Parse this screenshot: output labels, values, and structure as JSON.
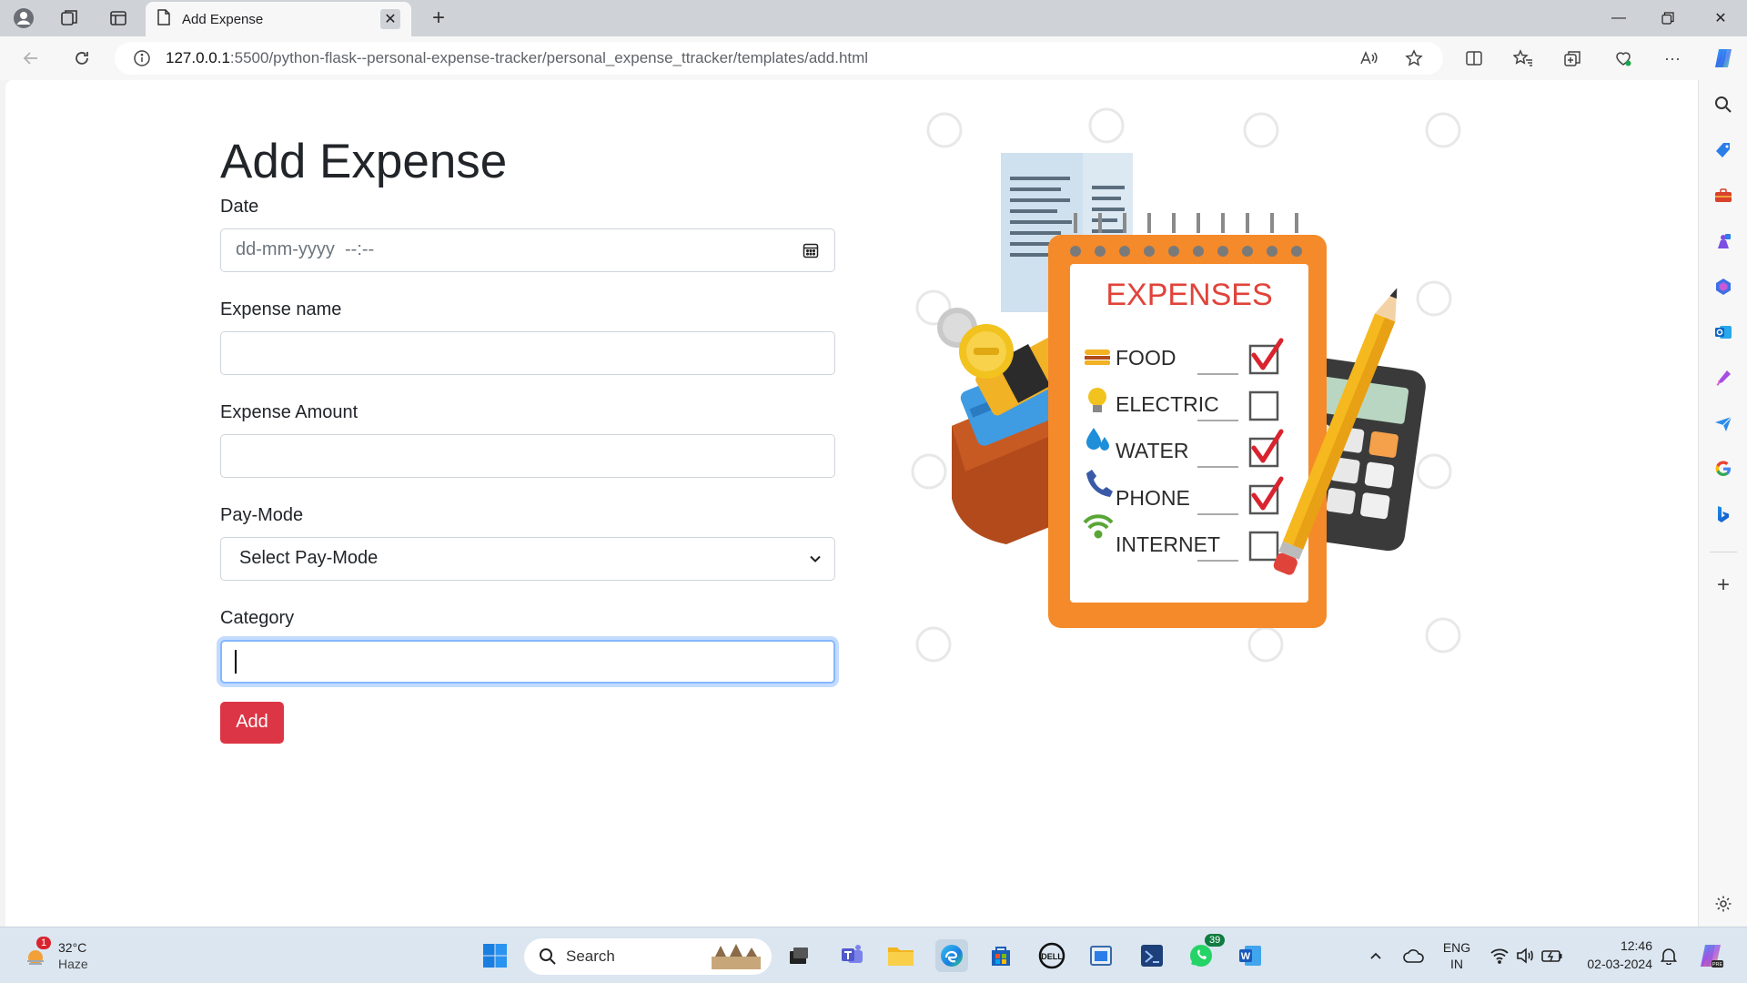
{
  "browser": {
    "tab_title": "Add Expense",
    "url_host": "127.0.0.1",
    "url_path": ":5500/python-flask--personal-expense-tracker/personal_expense_ttracker/templates/add.html"
  },
  "form": {
    "title": "Add Expense",
    "date_label": "Date",
    "date_placeholder": "dd-mm-yyyy  --:--",
    "name_label": "Expense name",
    "name_value": "",
    "amount_label": "Expense Amount",
    "amount_value": "",
    "paymode_label": "Pay-Mode",
    "paymode_selected": "Select Pay-Mode",
    "category_label": "Category",
    "category_value": "",
    "submit_label": "Add"
  },
  "illustration": {
    "heading": "EXPENSES",
    "items": [
      {
        "label": "FOOD",
        "checked": true
      },
      {
        "label": "ELECTRIC",
        "checked": false
      },
      {
        "label": "WATER",
        "checked": true
      },
      {
        "label": "PHONE",
        "checked": true
      },
      {
        "label": "INTERNET",
        "checked": false
      }
    ]
  },
  "taskbar": {
    "weather_temp": "32°C",
    "weather_desc": "Haze",
    "weather_badge": "1",
    "search_placeholder": "Search",
    "whatsapp_badge": "39",
    "lang_line1": "ENG",
    "lang_line2": "IN",
    "time": "12:46",
    "date": "02-03-2024"
  },
  "colors": {
    "danger": "#dc3545",
    "focus_ring": "#86b7fe",
    "notebook_orange": "#f58a2a"
  }
}
